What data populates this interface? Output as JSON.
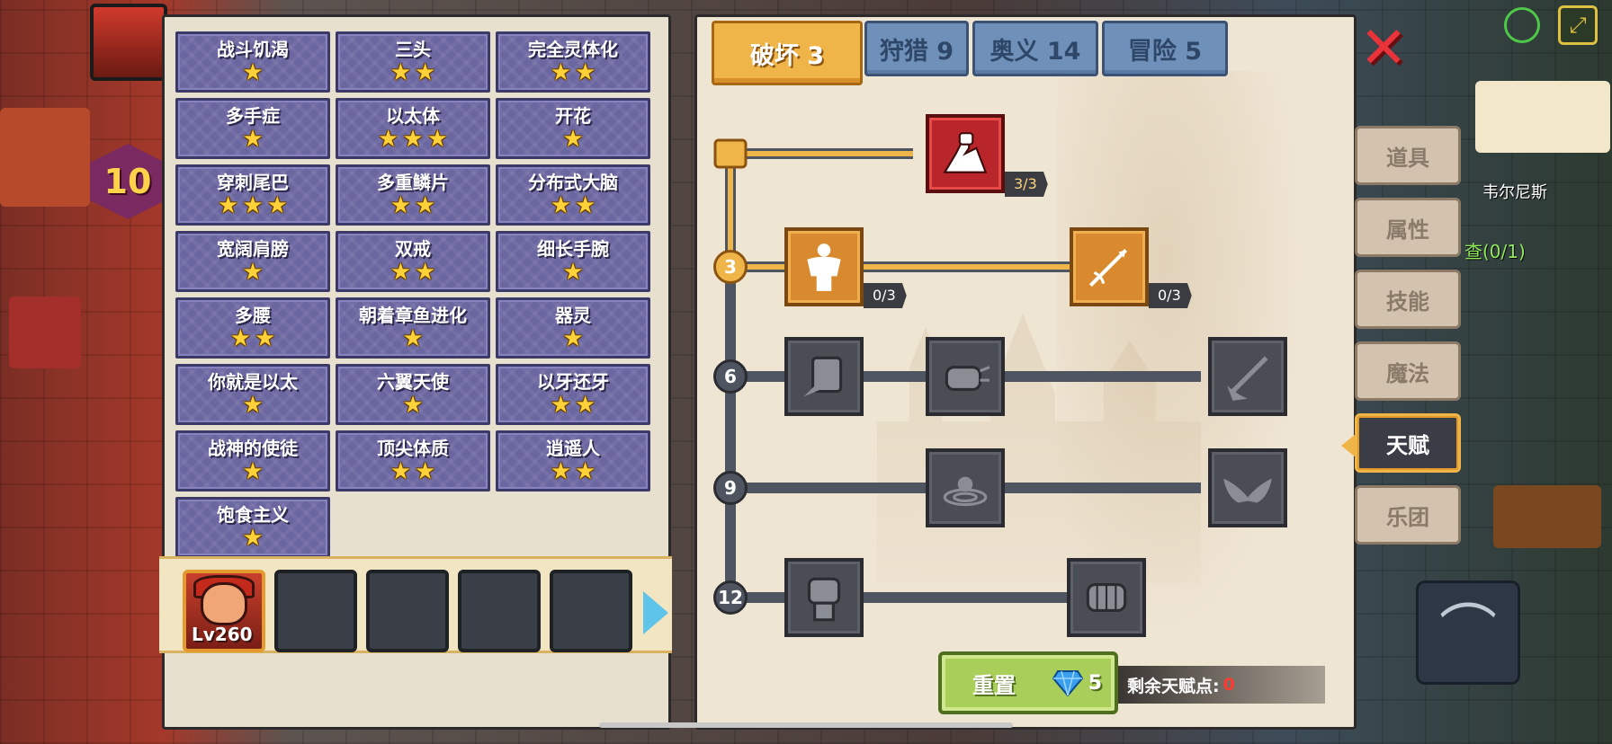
{
  "titles": [
    {
      "name": "战斗饥渴",
      "stars": 1
    },
    {
      "name": "三头",
      "stars": 2
    },
    {
      "name": "完全灵体化",
      "stars": 2
    },
    {
      "name": "多手症",
      "stars": 1
    },
    {
      "name": "以太体",
      "stars": 3
    },
    {
      "name": "开花",
      "stars": 1
    },
    {
      "name": "穿刺尾巴",
      "stars": 3
    },
    {
      "name": "多重鳞片",
      "stars": 2
    },
    {
      "name": "分布式大脑",
      "stars": 2
    },
    {
      "name": "宽阔肩膀",
      "stars": 1
    },
    {
      "name": "双戒",
      "stars": 2
    },
    {
      "name": "细长手腕",
      "stars": 1
    },
    {
      "name": "多腰",
      "stars": 2
    },
    {
      "name": "朝着章鱼进化",
      "stars": 1
    },
    {
      "name": "器灵",
      "stars": 1
    },
    {
      "name": "你就是以太",
      "stars": 1
    },
    {
      "name": "六翼天使",
      "stars": 1
    },
    {
      "name": "以牙还牙",
      "stars": 2
    },
    {
      "name": "战神的使徒",
      "stars": 1
    },
    {
      "name": "顶尖体质",
      "stars": 2
    },
    {
      "name": "逍遥人",
      "stars": 2
    },
    {
      "name": "饱食主义",
      "stars": 1
    }
  ],
  "team": {
    "hero_level": "Lv260"
  },
  "tabs": [
    {
      "label": "破坏 3",
      "active": true
    },
    {
      "label": "狩猎 9",
      "active": false
    },
    {
      "label": "奥义 14",
      "active": false
    },
    {
      "label": "冒险 5",
      "active": false
    }
  ],
  "tree": {
    "levels": [
      "3",
      "6",
      "9",
      "12"
    ],
    "nodes": [
      {
        "id": "arm-wrestle",
        "icon": "arm-wrestle-icon",
        "state": "maxed",
        "count": "3/3"
      },
      {
        "id": "muscle-body",
        "icon": "muscle-body-icon",
        "state": "unlocked",
        "count": "0/3"
      },
      {
        "id": "piercing-arrow",
        "icon": "piercing-arrow-icon",
        "state": "unlocked",
        "count": "0/3"
      },
      {
        "id": "card-slash",
        "icon": "card-slash-icon",
        "state": "locked"
      },
      {
        "id": "punch",
        "icon": "punch-icon",
        "state": "locked"
      },
      {
        "id": "sword-strike",
        "icon": "sword-strike-icon",
        "state": "locked"
      },
      {
        "id": "ripple",
        "icon": "ripple-icon",
        "state": "locked"
      },
      {
        "id": "bat-wings",
        "icon": "bat-wings-icon",
        "state": "locked"
      },
      {
        "id": "raised-fist",
        "icon": "raised-fist-icon",
        "state": "locked"
      },
      {
        "id": "grip-fist",
        "icon": "grip-fist-icon",
        "state": "locked"
      }
    ]
  },
  "reset": {
    "label": "重置",
    "cost": "5"
  },
  "points": {
    "label": "剩余天赋点:",
    "value": "0"
  },
  "side_menu": [
    {
      "label": "道具",
      "active": false
    },
    {
      "label": "属性",
      "active": false
    },
    {
      "label": "技能",
      "active": false
    },
    {
      "label": "魔法",
      "active": false
    },
    {
      "label": "天赋",
      "active": true
    },
    {
      "label": "乐团",
      "active": false
    }
  ],
  "hud": {
    "player_level": "10",
    "location": "韦尔尼斯",
    "quest": "查(0/1)"
  },
  "colors": {
    "accent_gold": "#f0b548",
    "tab_blue": "#6f90b8",
    "title_purple": "#6a66a0",
    "close_red": "#e8333a",
    "points_red": "#ff3a30"
  }
}
